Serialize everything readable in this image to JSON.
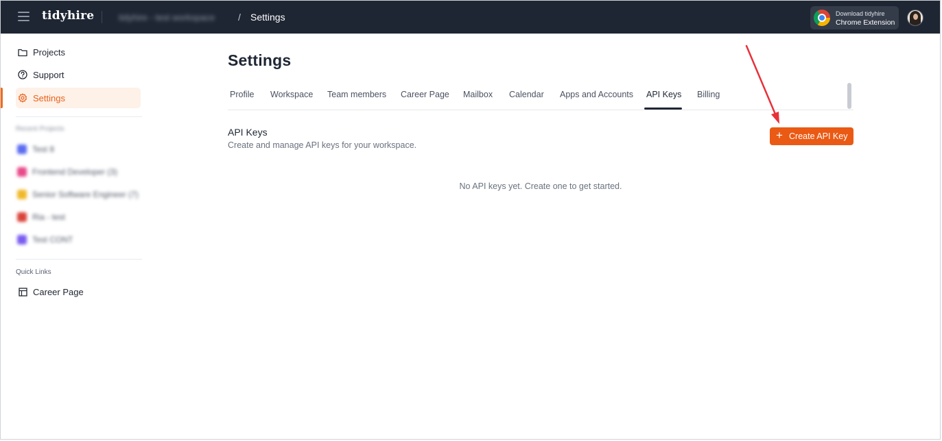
{
  "header": {
    "brand": "tidyhire",
    "workspace_name": "tidyhire - test workspace",
    "breadcrumb_separator": "/",
    "breadcrumb_current": "Settings",
    "chrome_extension": {
      "line1": "Download tidyhire",
      "line2": "Chrome Extension"
    }
  },
  "sidebar": {
    "nav": [
      {
        "label": "Projects",
        "icon": "folder-icon"
      },
      {
        "label": "Support",
        "icon": "question-circle-icon"
      },
      {
        "label": "Settings",
        "icon": "gear-icon",
        "active": true
      }
    ],
    "recent_projects_label": "Recent Projects",
    "recent_projects": [
      {
        "label": "Test 8",
        "color": "#5b6cf0"
      },
      {
        "label": "Frontend Developer (3)",
        "color": "#e84a8a"
      },
      {
        "label": "Senior Software Engineer (7)",
        "color": "#f0b92a"
      },
      {
        "label": "Ria - test",
        "color": "#d9443a"
      },
      {
        "label": "Test CONT",
        "color": "#7a5cf0"
      }
    ],
    "quick_links_label": "Quick Links",
    "quick_links": [
      {
        "label": "Career Page",
        "icon": "layout-icon"
      }
    ]
  },
  "main": {
    "title": "Settings",
    "tabs": [
      {
        "label": "Profile"
      },
      {
        "label": "Workspace"
      },
      {
        "label": "Team members"
      },
      {
        "label": "Career Page"
      },
      {
        "label": "Mailbox"
      },
      {
        "label": "Calendar"
      },
      {
        "label": "Apps and Accounts"
      },
      {
        "label": "API Keys",
        "active": true
      },
      {
        "label": "Billing"
      }
    ],
    "section_title": "API Keys",
    "section_description": "Create and manage API keys for your workspace.",
    "create_button_label": "Create API Key",
    "create_button_icon": "plus-icon",
    "empty_message": "No API keys yet. Create one to get started."
  },
  "colors": {
    "topbar": "#1f2633",
    "accent": "#ea5a14",
    "annotation_arrow": "#e8303a"
  }
}
